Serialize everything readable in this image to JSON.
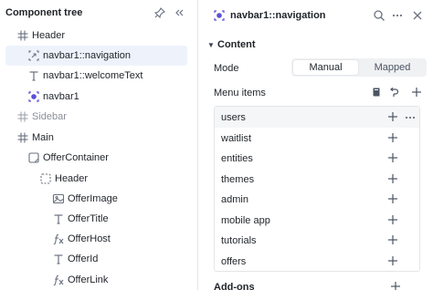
{
  "left_panel": {
    "title": "Component tree",
    "tree": [
      {
        "label": "Header",
        "icon": "grid-hash-icon",
        "muted": false
      },
      {
        "label": "navbar1::navigation",
        "icon": "navigation-link-icon",
        "muted": false,
        "selected": true
      },
      {
        "label": "navbar1::welcomeText",
        "icon": "text-icon",
        "muted": false
      },
      {
        "label": "navbar1",
        "icon": "component-icon",
        "muted": false
      },
      {
        "label": "Sidebar",
        "icon": "grid-hash-icon",
        "muted": true
      },
      {
        "label": "Main",
        "icon": "grid-hash-icon",
        "muted": false
      },
      {
        "label": "OfferContainer",
        "icon": "container-icon",
        "muted": false
      },
      {
        "label": "Header",
        "icon": "dashed-box-icon",
        "muted": false
      },
      {
        "label": "OfferImage",
        "icon": "image-icon",
        "muted": false
      },
      {
        "label": "OfferTitle",
        "icon": "text-icon",
        "muted": false
      },
      {
        "label": "OfferHost",
        "icon": "function-icon",
        "muted": false
      },
      {
        "label": "OfferId",
        "icon": "text-icon",
        "muted": false
      },
      {
        "label": "OfferLink",
        "icon": "function-icon",
        "muted": false
      }
    ]
  },
  "right_panel": {
    "title": "navbar1::navigation",
    "section": "Content",
    "mode_label": "Mode",
    "mode_options": [
      "Manual",
      "Mapped"
    ],
    "mode_selected": "Manual",
    "menu_items_label": "Menu items",
    "menu_items": [
      "users",
      "waitlist",
      "entities",
      "themes",
      "admin",
      "mobile app",
      "tutorials",
      "offers"
    ],
    "addons_label": "Add-ons"
  },
  "colors": {
    "selection": "#eef3fb",
    "accent_purple": "#5b4fd6"
  }
}
